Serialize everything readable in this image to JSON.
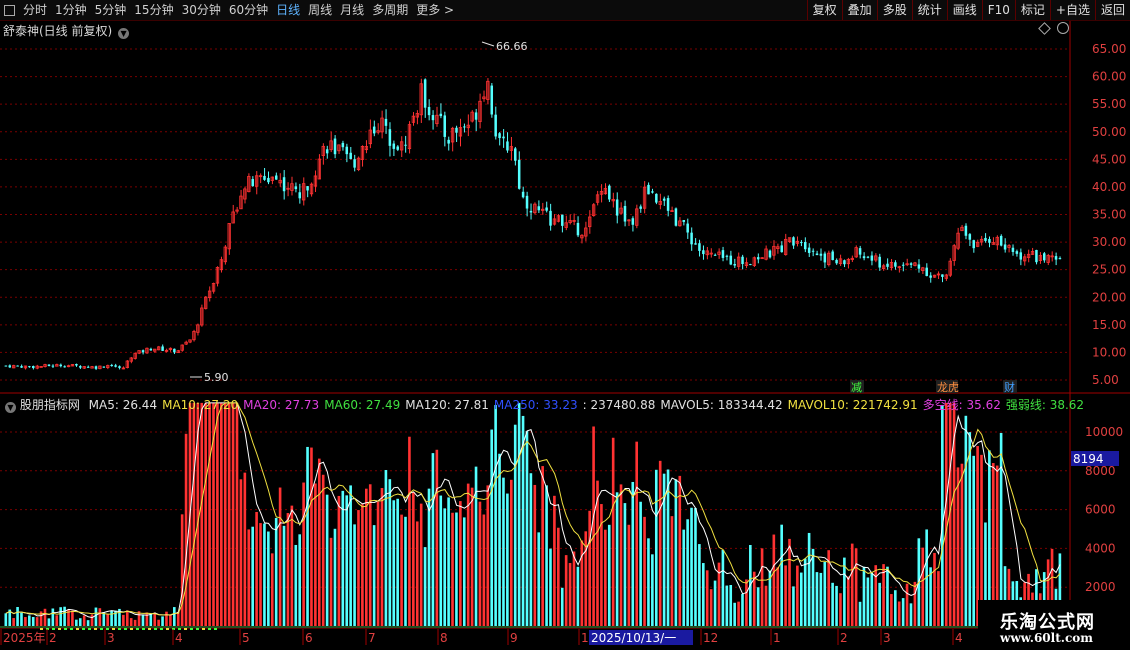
{
  "toolbar": {
    "tabs": [
      "分时",
      "1分钟",
      "5分钟",
      "15分钟",
      "30分钟",
      "60分钟",
      "日线",
      "周线",
      "月线",
      "多周期",
      "更多"
    ],
    "active_tab": "日线",
    "right_buttons": [
      "复权",
      "叠加",
      "多股",
      "统计",
      "画线",
      "F10",
      "标记",
      "+自选",
      "返回"
    ]
  },
  "main_chart": {
    "title": "舒泰神(日线 前复权)",
    "y_ticks": [
      "65.00",
      "60.00",
      "55.00",
      "50.00",
      "45.00",
      "40.00",
      "35.00",
      "30.00",
      "25.00",
      "20.00",
      "15.00",
      "10.00",
      "5.00"
    ],
    "high_label": "66.66",
    "low_label": "5.90",
    "markers": [
      "减",
      "龙虎",
      "财"
    ]
  },
  "indicator": {
    "name": "股朋指标网",
    "items": [
      {
        "text": "MA5: 26.44",
        "color": "#e0e0e0"
      },
      {
        "text": "MA10: 27.20",
        "color": "#f0e040"
      },
      {
        "text": "MA20: 27.73",
        "color": "#e040e0"
      },
      {
        "text": "MA60: 27.49",
        "color": "#40e040"
      },
      {
        "text": "MA120: 27.81",
        "color": "#e0e0e0"
      },
      {
        "text": "MA250: 33.23",
        "color": "#3050ff"
      },
      {
        "text": ": 237480.88",
        "color": "#e0e0e0"
      },
      {
        "text": "MAVOL5: 183344.42",
        "color": "#e0e0e0"
      },
      {
        "text": "MAVOL10: 221742.91",
        "color": "#f0e040"
      },
      {
        "text": "多空线: 35.62",
        "color": "#e040e0"
      },
      {
        "text": "强弱线: 38.62",
        "color": "#40e040"
      }
    ],
    "y_ticks": [
      "10000",
      "8000",
      "6000",
      "4000",
      "2000"
    ],
    "current_label": "8194"
  },
  "x_axis": {
    "labels": [
      "2025年",
      "2",
      "3",
      "4",
      "5",
      "6",
      "7",
      "8",
      "9",
      "1",
      "12",
      "1",
      "2",
      "3",
      "4"
    ],
    "highlight": "2025/10/13/一"
  },
  "watermark": {
    "line1": "乐淘公式网",
    "line2": "www.60lt.com"
  },
  "colors": {
    "up": "#ff3232",
    "down": "#54ffff",
    "grid": "#7a0000",
    "axis_text": "#e04040"
  }
}
